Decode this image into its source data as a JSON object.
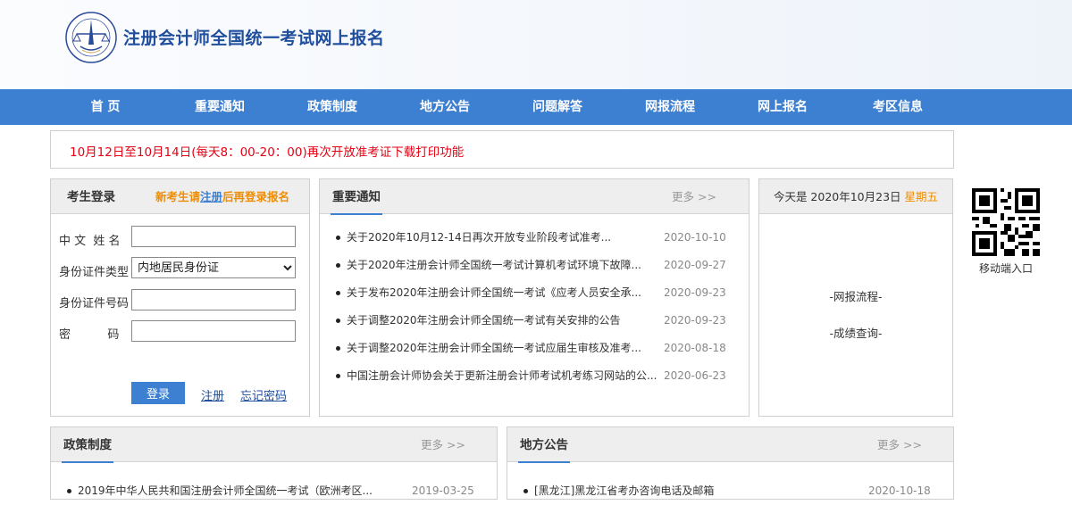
{
  "site": {
    "title": "注册会计师全国统一考试网上报名"
  },
  "nav": {
    "items": [
      "首 页",
      "重要通知",
      "政策制度",
      "地方公告",
      "问题解答",
      "网报流程",
      "网上报名",
      "考区信息"
    ]
  },
  "notice": {
    "text": "10月12日至10月14日(每天8：00-20：00)再次开放准考证下载打印功能"
  },
  "login": {
    "title": "考生登录",
    "hint_prefix": "新考生请",
    "hint_link": "注册",
    "hint_suffix": "后再登录报名",
    "name_label": "中 文  姓 名",
    "idtype_label": "身份证件类型",
    "idtype_value": "内地居民身份证",
    "idnum_label": "身份证件号码",
    "password_label": "密          码",
    "login_button": "登录",
    "register_link": "注册",
    "forgot_link": "忘记密码"
  },
  "important": {
    "title": "重要通知",
    "more": "更多 >>",
    "items": [
      {
        "text": "关于2020年10月12-14日再次开放专业阶段考试准考...",
        "date": "2020-10-10"
      },
      {
        "text": "关于2020年注册会计师全国统一考试计算机考试环境下故障...",
        "date": "2020-09-27"
      },
      {
        "text": "关于发布2020年注册会计师全国统一考试《应考人员安全承...",
        "date": "2020-09-23"
      },
      {
        "text": "关于调整2020年注册会计师全国统一考试有关安排的公告",
        "date": "2020-09-23"
      },
      {
        "text": "关于调整2020年注册会计师全国统一考试应届生审核及准考...",
        "date": "2020-08-18"
      },
      {
        "text": "中国注册会计师协会关于更新注册会计师考试机考练习网站的公...",
        "date": "2020-06-23"
      }
    ]
  },
  "today": {
    "prefix": "今天是 2020年10月23日",
    "weekday": "星期五",
    "link1": "-网报流程-",
    "link2": "-成绩查询-"
  },
  "mobile": {
    "label": "移动端入口"
  },
  "policy": {
    "title": "政策制度",
    "more": "更多 >>",
    "items": [
      {
        "text": "2019年中华人民共和国注册会计师全国统一考试（欧洲考区...",
        "date": "2019-03-25"
      }
    ]
  },
  "local": {
    "title": "地方公告",
    "more": "更多 >>",
    "items": [
      {
        "text": "[黑龙江]黑龙江省考办咨询电话及邮箱",
        "date": "2020-10-18"
      }
    ]
  },
  "colors": {
    "nav_bg": "#3d7fd0",
    "notice_red": "#e60012",
    "hint_orange": "#f08c00",
    "title_blue": "#1f4e9c"
  }
}
